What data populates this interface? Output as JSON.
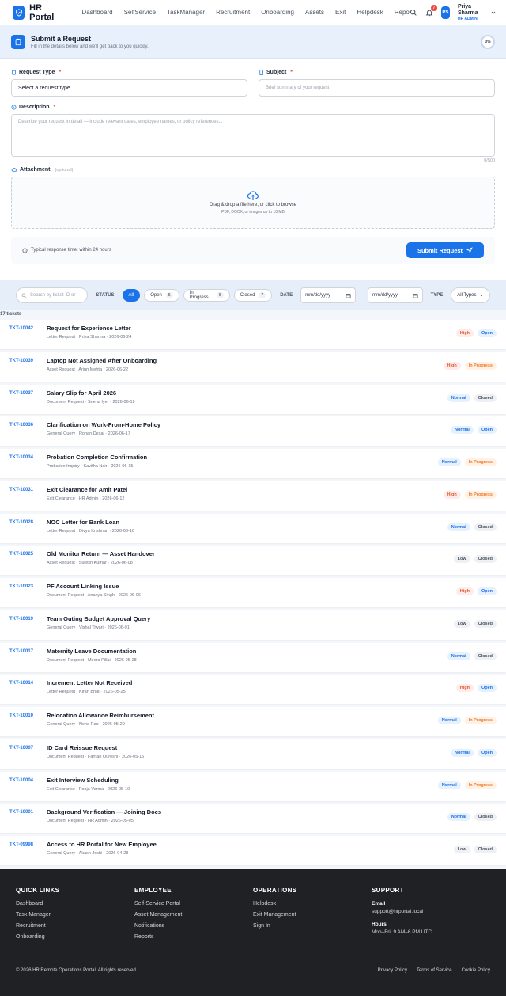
{
  "app": {
    "name": "HR Portal",
    "nav": [
      "Dashboard",
      "SelfService",
      "TaskManager",
      "Recruitment",
      "Onboarding",
      "Assets",
      "Exit",
      "Helpdesk",
      "Repo"
    ],
    "notifications": "7",
    "user": {
      "initials": "PS",
      "name": "Priya Sharma",
      "role": "HR ADMIN"
    }
  },
  "form": {
    "title": "Submit a Request",
    "subtitle": "Fill in the details below and we'll get back to you quickly.",
    "progress": "0%",
    "request_type": {
      "label": "Request Type",
      "value": "Select a request type..."
    },
    "subject": {
      "label": "Subject",
      "placeholder": "Brief summary of your request"
    },
    "description": {
      "label": "Description",
      "placeholder": "Describe your request in detail — include relevant dates, employee names, or policy references...",
      "counter": "0/500"
    },
    "attachment": {
      "label": "Attachment",
      "optional": "(optional)",
      "drop_text": "Drag & drop a file here, or click to browse",
      "hint": "PDF, DOCX, or images up to 10 MB"
    },
    "response_time": "Typical response time: within 24 hours",
    "submit": "Submit Request"
  },
  "filters": {
    "search_placeholder": "Search by ticket ID or",
    "status_label": "STATUS",
    "chips": [
      {
        "label": "All",
        "count": ""
      },
      {
        "label": "Open",
        "count": "5"
      },
      {
        "label": "In Progress",
        "count": "5"
      },
      {
        "label": "Closed",
        "count": "7"
      }
    ],
    "date_label": "DATE",
    "date_from": "mm/dd/yyyy",
    "date_sep": "–",
    "date_to": "mm/dd/yyyy",
    "type_label": "TYPE",
    "type_value": "All Types"
  },
  "ticket_count": "17 tickets",
  "tickets": [
    {
      "id": "TKT-10042",
      "title": "Request for Experience Letter",
      "meta": "Letter Request · Priya Sharma · 2026-06-24",
      "priority": "High",
      "status": "Open"
    },
    {
      "id": "TKT-10039",
      "title": "Laptop Not Assigned After Onboarding",
      "meta": "Asset Request · Arjun Mehta · 2026-06-22",
      "priority": "High",
      "status": "In Progress"
    },
    {
      "id": "TKT-10037",
      "title": "Salary Slip for April 2026",
      "meta": "Document Request · Sneha Iyer · 2026-06-19",
      "priority": "Normal",
      "status": "Closed"
    },
    {
      "id": "TKT-10036",
      "title": "Clarification on Work-From-Home Policy",
      "meta": "General Query · Rohan Desai · 2026-06-17",
      "priority": "Normal",
      "status": "Open"
    },
    {
      "id": "TKT-10034",
      "title": "Probation Completion Confirmation",
      "meta": "Probation Inquiry · Kavitha Nair · 2026-06-15",
      "priority": "Normal",
      "status": "In Progress"
    },
    {
      "id": "TKT-10031",
      "title": "Exit Clearance for Amit Patel",
      "meta": "Exit Clearance · HR Admin · 2026-06-12",
      "priority": "High",
      "status": "In Progress"
    },
    {
      "id": "TKT-10028",
      "title": "NOC Letter for Bank Loan",
      "meta": "Letter Request · Divya Krishnan · 2026-06-10",
      "priority": "Normal",
      "status": "Closed"
    },
    {
      "id": "TKT-10025",
      "title": "Old Monitor Return — Asset Handover",
      "meta": "Asset Request · Suresh Kumar · 2026-06-08",
      "priority": "Low",
      "status": "Closed"
    },
    {
      "id": "TKT-10023",
      "title": "PF Account Linking Issue",
      "meta": "Document Request · Ananya Singh · 2026-06-06",
      "priority": "High",
      "status": "Open"
    },
    {
      "id": "TKT-10019",
      "title": "Team Outing Budget Approval Query",
      "meta": "General Query · Vishal Tiwari · 2026-06-01",
      "priority": "Low",
      "status": "Closed"
    },
    {
      "id": "TKT-10017",
      "title": "Maternity Leave Documentation",
      "meta": "Document Request · Meera Pillai · 2026-05-28",
      "priority": "Normal",
      "status": "Closed"
    },
    {
      "id": "TKT-10014",
      "title": "Increment Letter Not Received",
      "meta": "Letter Request · Kiran Bhat · 2026-05-25",
      "priority": "High",
      "status": "Open"
    },
    {
      "id": "TKT-10010",
      "title": "Relocation Allowance Reimbursement",
      "meta": "General Query · Neha Rao · 2026-05-20",
      "priority": "Normal",
      "status": "In Progress"
    },
    {
      "id": "TKT-10007",
      "title": "ID Card Reissue Request",
      "meta": "Document Request · Farhan Qureshi · 2026-05-15",
      "priority": "Normal",
      "status": "Open"
    },
    {
      "id": "TKT-10004",
      "title": "Exit Interview Scheduling",
      "meta": "Exit Clearance · Pooja Verma · 2026-05-10",
      "priority": "Normal",
      "status": "In Progress"
    },
    {
      "id": "TKT-10001",
      "title": "Background Verification — Joining Docs",
      "meta": "Document Request · HR Admin · 2026-05-05",
      "priority": "Normal",
      "status": "Closed"
    },
    {
      "id": "TKT-09998",
      "title": "Access to HR Portal for New Employee",
      "meta": "General Query · Akash Joshi · 2026-04-28",
      "priority": "Low",
      "status": "Closed"
    }
  ],
  "footer": {
    "quick_links": {
      "title": "QUICK LINKS",
      "items": [
        "Dashboard",
        "Task Manager",
        "Recruitment",
        "Onboarding"
      ]
    },
    "employee": {
      "title": "EMPLOYEE",
      "items": [
        "Self-Service Portal",
        "Asset Management",
        "Notifications",
        "Reports"
      ]
    },
    "operations": {
      "title": "OPERATIONS",
      "items": [
        "Helpdesk",
        "Exit Management",
        "Sign In"
      ]
    },
    "support": {
      "title": "SUPPORT",
      "email_label": "Email",
      "email": "support@hrportal.local",
      "hours_label": "Hours",
      "hours": "Mon–Fri, 9 AM–6 PM UTC"
    },
    "copyright": "© 2026 HR Remote Operations Portal. All rights reserved.",
    "legal": [
      "Privacy Policy",
      "Terms of Service",
      "Cookie Policy"
    ]
  },
  "colors": {
    "accent": "#1a73e8",
    "footer_bg": "#202124",
    "danger": "#ef4444"
  }
}
